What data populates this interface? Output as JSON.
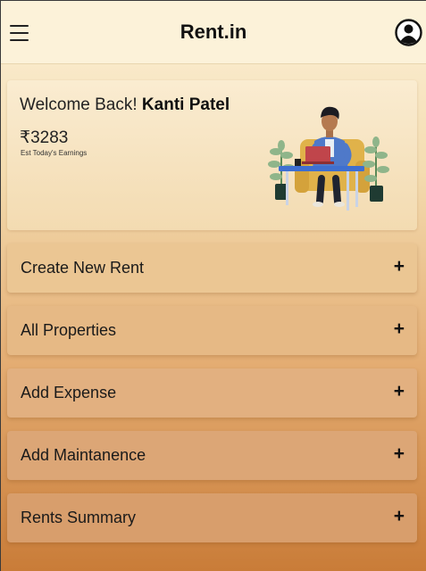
{
  "header": {
    "title": "Rent.in",
    "menu_icon": "hamburger-menu-icon",
    "profile_icon": "user-circle-icon"
  },
  "welcome": {
    "greeting": "Welcome Back!",
    "user_name": "Kanti Patel",
    "earnings": "₹3283",
    "earnings_label": "Est Today's Earnings"
  },
  "actions": [
    {
      "label": "Create New Rent",
      "icon": "plus-icon"
    },
    {
      "label": "All Properties",
      "icon": "plus-icon"
    },
    {
      "label": "Add Expense",
      "icon": "plus-icon"
    },
    {
      "label": "Add Maintanence",
      "icon": "plus-icon"
    },
    {
      "label": "Rents Summary",
      "icon": "plus-icon"
    }
  ],
  "colors": {
    "header_bg": "#fcf2d9",
    "gradient_top": "#fcf1d8",
    "gradient_bottom": "#c97c38",
    "accent_blue": "#4a73c9"
  }
}
